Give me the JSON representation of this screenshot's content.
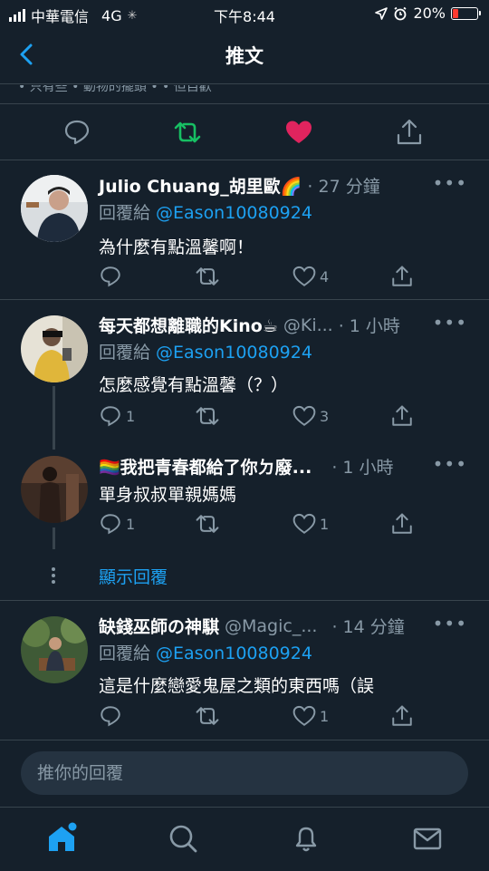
{
  "status_bar": {
    "carrier": "中華電信",
    "network": "4G",
    "time": "下午8:44",
    "battery": "20%"
  },
  "header": {
    "title": "推文"
  },
  "faded_top_text": "• 只有些 • 動物的擺頭 • • 但自歡",
  "colors": {
    "accent": "#1da1f2",
    "retweet": "#17bf63",
    "like": "#e0245e",
    "background": "#15202b",
    "secondary_text": "#8899a6"
  },
  "tweet_actions": [
    {
      "icon": "reply-icon"
    },
    {
      "icon": "retweet-icon",
      "state": "active"
    },
    {
      "icon": "heart-filled-icon",
      "state": "liked"
    },
    {
      "icon": "share-icon"
    }
  ],
  "replies": [
    {
      "name": "Julio Chuang_胡里歐🌈",
      "handle": "",
      "time": "· 27 分鐘",
      "replying_label": "回覆給",
      "replying_to": "@Eason10080924",
      "text": "為什麼有點溫馨啊！",
      "reply_count": "",
      "like_count": "4"
    },
    {
      "name": "每天都想離職的Kino☕",
      "handle": "@Ki...",
      "time": "· 1 小時",
      "replying_label": "回覆給",
      "replying_to": "@Eason10080924",
      "text": "怎麼感覺有點溫馨（？）",
      "reply_count": "1",
      "like_count": "3"
    },
    {
      "name": "🏳️‍🌈我把青春都給了你ㄉ廢...",
      "handle": "",
      "time": "· 1 小時",
      "replying_label": "",
      "replying_to": "",
      "text": "單身叔叔單親媽媽",
      "reply_count": "1",
      "like_count": "1"
    },
    {
      "name": "缺錢巫師の神騏",
      "handle": "@Magic_...",
      "time": "· 14 分鐘",
      "replying_label": "回覆給",
      "replying_to": "@Eason10080924",
      "text": "這是什麼戀愛鬼屋之類的東西嗎（誤",
      "reply_count": "",
      "like_count": "1"
    }
  ],
  "show_replies": "顯示回覆",
  "more_glyph": "•••",
  "reply_bar": {
    "placeholder": "推你的回覆"
  },
  "tab_bar": [
    {
      "icon": "home-icon",
      "state": "active"
    },
    {
      "icon": "search-icon"
    },
    {
      "icon": "notifications-icon"
    },
    {
      "icon": "messages-icon"
    }
  ]
}
